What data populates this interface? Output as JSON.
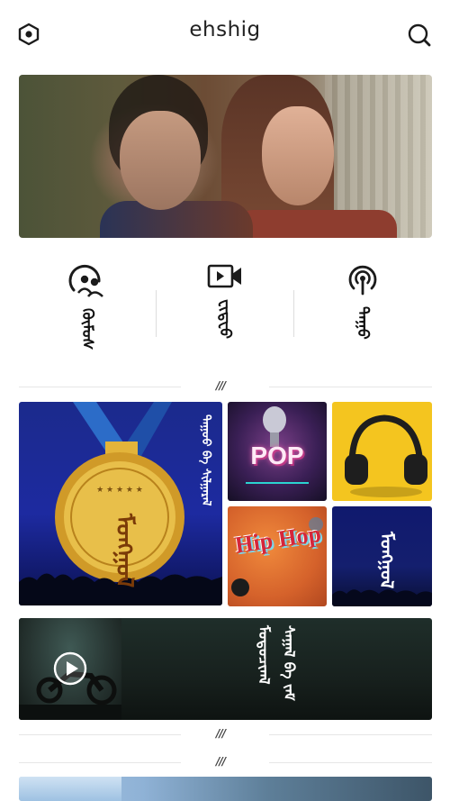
{
  "header": {
    "title": "ehshig",
    "settings_icon": "hexagon-settings-icon",
    "search_icon": "search-icon"
  },
  "banner": {
    "image": "two-women-portrait-banner"
  },
  "categories": [
    {
      "icon": "podcast-people-icon",
      "label": "ᠬᠦᠮᠦᠰ"
    },
    {
      "icon": "video-camera-icon",
      "label": "ᠸᠢᠳᠧᠣ"
    },
    {
      "icon": "podcast-icon",
      "label": "ᠳᠠᠭᠤ"
    }
  ],
  "separator_mark": "///",
  "tiles": {
    "medal": {
      "label": "ᠳᠠᠭᠤᠤ ᠪᠠ ᠰᠢᠯᠭᠠᠷᠠᠯ",
      "medal_text": "ᠮᠣᠩᠭᠣᠯ"
    },
    "pop": {
      "label": "POP"
    },
    "headphones": {
      "label": ""
    },
    "hiphop": {
      "label": "Hip Hop"
    },
    "mongol": {
      "label": "ᠮᠣᠩᠭᠣᠯ"
    }
  },
  "video": {
    "title": "ᠮᠣᠲᠣᠴᠢᠭᠯ ᠰᠠᠭᠠᠯ ᠪᠠ ᠵᠠᠮ"
  },
  "colors": {
    "text": "#222222",
    "divider": "#e6e6e6",
    "medal_gold": "#e3b43a",
    "pop_pink": "#e05aa8",
    "headphones_yellow": "#f4c51f",
    "mongol_blue": "#10196e"
  }
}
